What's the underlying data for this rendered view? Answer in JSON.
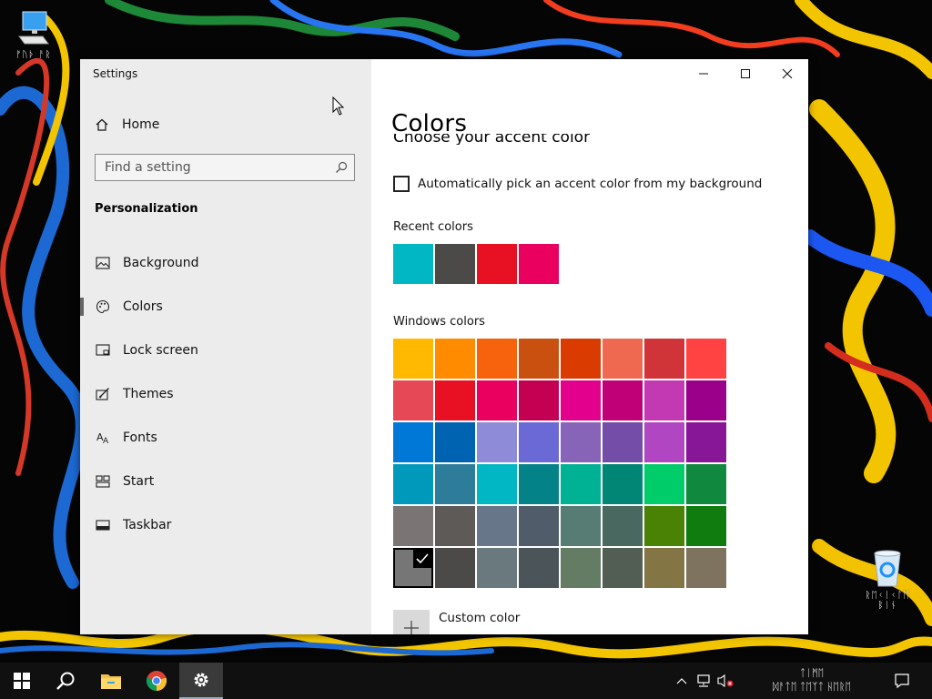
{
  "desktop": {
    "this_pc_label": "ᚠᚢᚦ ᚨᚱ",
    "recycle_bin_label_line1": "ᚱᛖᚲᛁᚲᛚᛖ",
    "recycle_bin_label_line2": "ᛒᛁᚾ"
  },
  "window": {
    "title": "Settings",
    "controls": {
      "minimize": "minimize-icon",
      "maximize": "maximize-icon",
      "close": "close-icon"
    }
  },
  "sidebar": {
    "home_label": "Home",
    "search_placeholder": "Find a setting",
    "section_heading": "Personalization",
    "items": [
      {
        "label": "Background",
        "icon": "picture-icon"
      },
      {
        "label": "Colors",
        "icon": "palette-icon",
        "active": true
      },
      {
        "label": "Lock screen",
        "icon": "lock-screen-icon"
      },
      {
        "label": "Themes",
        "icon": "themes-brush-icon"
      },
      {
        "label": "Fonts",
        "icon": "fonts-icon"
      },
      {
        "label": "Start",
        "icon": "start-layout-icon"
      },
      {
        "label": "Taskbar",
        "icon": "taskbar-icon"
      }
    ]
  },
  "content": {
    "page_title": "Colors",
    "partial_subheading": "Choose your accent color",
    "auto_pick_label": "Automatically pick an accent color from my background",
    "recent_label": "Recent colors",
    "recent_colors": [
      "#00b7c3",
      "#4c4a48",
      "#e81123",
      "#ea005e"
    ],
    "windows_label": "Windows colors",
    "windows_colors": [
      [
        "#ffb900",
        "#ff8c00",
        "#f7630c",
        "#ca5010",
        "#da3b01",
        "#ef6950",
        "#d13438",
        "#ff4343"
      ],
      [
        "#e74856",
        "#e81123",
        "#ea005e",
        "#c30052",
        "#e3008c",
        "#bf0077",
        "#c239b3",
        "#9a0089"
      ],
      [
        "#0078d7",
        "#0063b1",
        "#8e8cd8",
        "#6b69d6",
        "#8764b8",
        "#744da9",
        "#b146c2",
        "#881798"
      ],
      [
        "#0099bc",
        "#2d7d9a",
        "#00b7c3",
        "#038387",
        "#00b294",
        "#018574",
        "#00cc6a",
        "#10893e"
      ],
      [
        "#7a7574",
        "#5d5a58",
        "#68768a",
        "#515c6b",
        "#567c73",
        "#486860",
        "#498205",
        "#107c10"
      ],
      [
        "#767676",
        "#4c4a48",
        "#69797e",
        "#4a5459",
        "#647c64",
        "#525e54",
        "#847545",
        "#7e735f"
      ]
    ],
    "selected_color": {
      "row": 5,
      "col": 0
    },
    "custom_color_label": "Custom color"
  },
  "taskbar": {
    "buttons": [
      "start-icon",
      "search-icon",
      "file-explorer-icon",
      "chrome-icon",
      "settings-gear-icon"
    ],
    "clock_time": "ᛏᛁᛗᛖ",
    "clock_date": "ᛞᚨᛏᛖ ᛏᛖᛉᛏ ᚺᛖᚱᛖ"
  }
}
